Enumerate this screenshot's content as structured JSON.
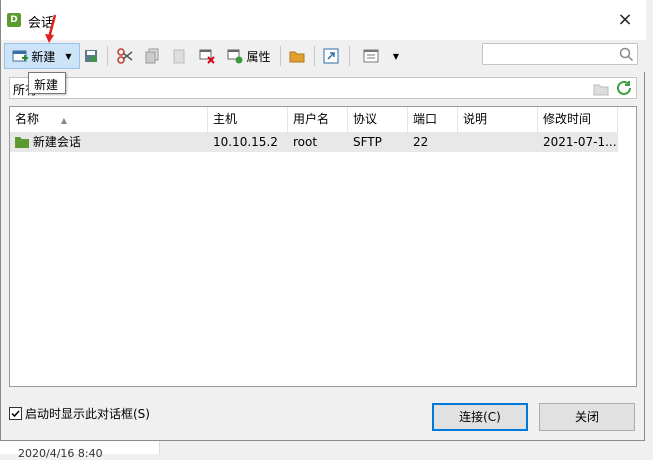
{
  "window": {
    "title": "会话",
    "app_icon_glyph": "D",
    "close_glyph": "×"
  },
  "toolbar": {
    "new_label": "新建",
    "properties_label": "属性",
    "tooltip": "新建"
  },
  "pathbar": {
    "text": "所有"
  },
  "table": {
    "columns": [
      "名称",
      "主机",
      "用户名",
      "协议",
      "端口",
      "说明",
      "修改时间"
    ],
    "rows": [
      {
        "name": "新建会话",
        "host": "10.10.15.2",
        "user": "root",
        "protocol": "SFTP",
        "port": "22",
        "description": "",
        "modified": "2021-07-1..."
      }
    ]
  },
  "footer": {
    "show_on_startup_label": "启动时显示此对话框(S)",
    "show_on_startup_checked": true,
    "connect_label": "连接(C)",
    "close_label": "关闭"
  },
  "background": {
    "partial_text": "2020/4/16  8:40"
  },
  "colors": {
    "accent": "#0078d7",
    "app_icon": "#5b9a2e",
    "selected_row": "#e8e8e8",
    "new_button_hover": "#cde3f7"
  }
}
